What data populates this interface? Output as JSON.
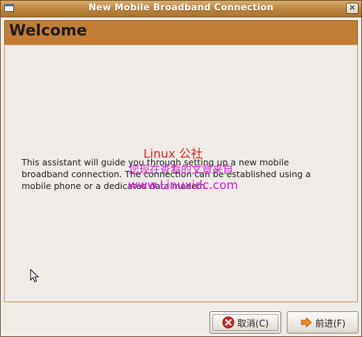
{
  "window": {
    "title": "New Mobile Broadband Connection",
    "close_glyph": "✕"
  },
  "header": {
    "title": "Welcome"
  },
  "content": {
    "intro": "This assistant will guide you through setting up a new mobile broadband connection. The connection can be established using a mobile phone or a dedicated data modem."
  },
  "watermark": {
    "line1": "Linux 公社",
    "line2": "您现在查看的文章来自",
    "line3": "www.Linuxidc.com"
  },
  "buttons": {
    "cancel_label": "取消(C)",
    "next_label": "前进(F)"
  },
  "colors": {
    "titlebar": "#c08a44",
    "header": "#c17d36",
    "background": "#efebe7",
    "cancel_icon": "#cc2222",
    "next_icon": "#f08a1a"
  },
  "icons": {
    "app": "window-icon",
    "close": "close-icon",
    "cancel": "cancel-icon",
    "next": "forward-arrow-icon",
    "cursor": "mouse-pointer-icon"
  }
}
